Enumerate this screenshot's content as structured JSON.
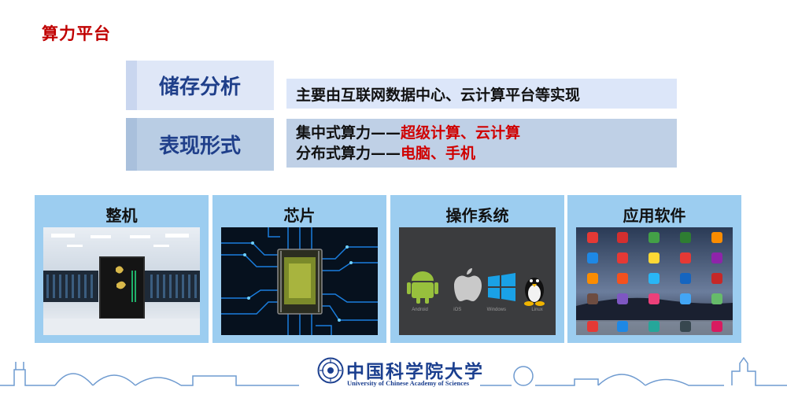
{
  "slide": {
    "title": "算力平台"
  },
  "rows": [
    {
      "label": "储存分析",
      "value": "主要由互联网数据中心、云计算平台等实现"
    },
    {
      "label": "表现形式",
      "lines": [
        {
          "prefix": "集中式算力——",
          "highlight": "超级计算、云计算"
        },
        {
          "prefix": "分布式算力——",
          "highlight": "电脑、手机"
        }
      ]
    }
  ],
  "cards": [
    {
      "title": "整机",
      "image": "supercomputer-photo"
    },
    {
      "title": "芯片",
      "image": "chip-circuit-photo"
    },
    {
      "title": "操作系统",
      "image": "os-logos",
      "os_labels": [
        "Android",
        "iOS",
        "Windows",
        "Linux"
      ]
    },
    {
      "title": "应用软件",
      "image": "app-grid-photo"
    }
  ],
  "footer": {
    "logo_cn": "中国科学院大学",
    "logo_en": "University of Chinese Academy of Sciences"
  },
  "colors": {
    "title_red": "#c00000",
    "label_blue": "#1f3f8a",
    "card_bg": "#9ccdf0",
    "highlight_red": "#d00000"
  }
}
